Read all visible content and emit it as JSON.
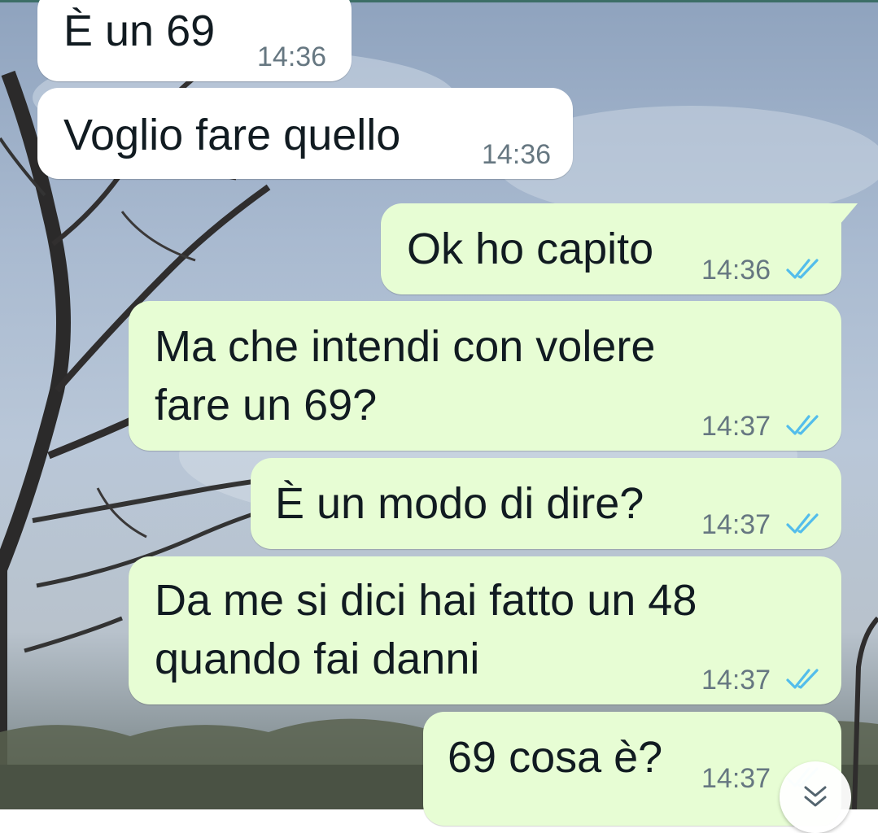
{
  "messages": [
    {
      "text": "È un 69",
      "time": "14:36",
      "direction": "incoming"
    },
    {
      "text": "Voglio fare quello",
      "time": "14:36",
      "direction": "incoming"
    },
    {
      "text": "Ok ho capito",
      "time": "14:36",
      "direction": "outgoing",
      "status": "read"
    },
    {
      "text": "Ma che intendi con volere\nfare un 69?",
      "time": "14:37",
      "direction": "outgoing",
      "status": "read"
    },
    {
      "text": "È un modo di dire?",
      "time": "14:37",
      "direction": "outgoing",
      "status": "read"
    },
    {
      "text": "Da me si dici hai fatto un 48\nquando fai danni",
      "time": "14:37",
      "direction": "outgoing",
      "status": "read"
    },
    {
      "text": "69 cosa è?",
      "time": "14:37",
      "direction": "outgoing",
      "status": "read"
    }
  ],
  "icons": {
    "read_receipt": "double-check-icon",
    "scroll_down": "chevron-double-down-icon"
  },
  "colors": {
    "incoming_bubble": "#ffffff",
    "outgoing_bubble": "#e7fdd4",
    "read_tick": "#53bdeb",
    "timestamp": "#667781"
  }
}
